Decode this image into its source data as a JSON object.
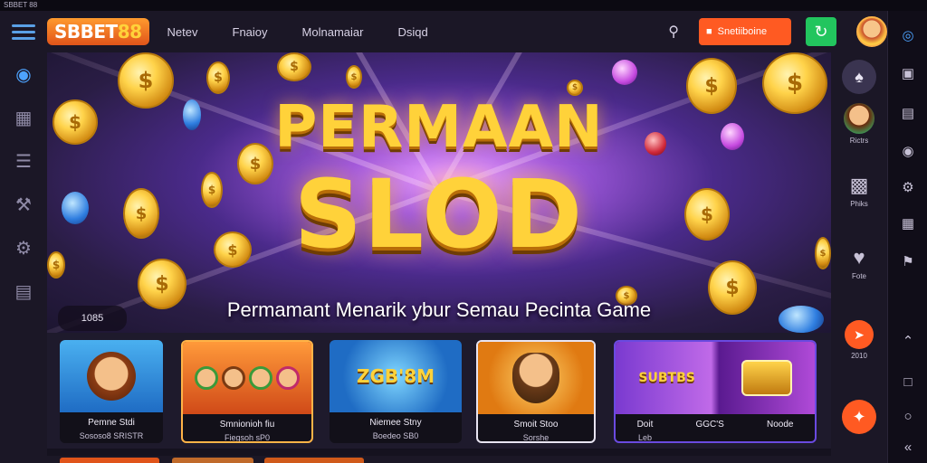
{
  "window": {
    "title": "SBBET 88"
  },
  "brand": {
    "logo_prefix": "S",
    "logo_name": "BBET",
    "logo_number": "88"
  },
  "nav": {
    "links": [
      "Netev",
      "Fnaioy",
      "Molnamaiar",
      "Dsiqd"
    ]
  },
  "header": {
    "promo_label": "Snetiiboine"
  },
  "hero": {
    "title_line1": "PERMAAN",
    "title_line2": "SLOD",
    "subtitle": "Permamant Menarik ybur Semau Pecinta Game",
    "corner_badge": "1085"
  },
  "games": [
    {
      "art": "",
      "title": "Pemne Stdi",
      "subtitle": "Sososo8 SRISTR"
    },
    {
      "art": "",
      "title": "Smnionioh fiu",
      "subtitle": "Fiegsoh sP0"
    },
    {
      "art": "ZGB'8M",
      "title": "Niemee Stny",
      "subtitle": "Boedeo SB0"
    },
    {
      "art": "",
      "title": "Smoit Stoo",
      "subtitle": "Sorshe"
    },
    {
      "art": "SUBTBS",
      "title": "Doit",
      "subtitle": "Leb"
    },
    {
      "art": "",
      "title": "GGC'S",
      "subtitle": ""
    },
    {
      "art": "",
      "title": "Noode",
      "subtitle": ""
    }
  ],
  "right_panel": {
    "items": [
      {
        "label": ""
      },
      {
        "label": "Rictrs"
      },
      {
        "label": "Phiks"
      },
      {
        "label": "Fote"
      },
      {
        "label": "2010"
      }
    ]
  },
  "colors": {
    "accent": "#ff5a22",
    "success": "#22c55e",
    "gold": "#ffd23a",
    "active_icon": "#4da3ff"
  }
}
